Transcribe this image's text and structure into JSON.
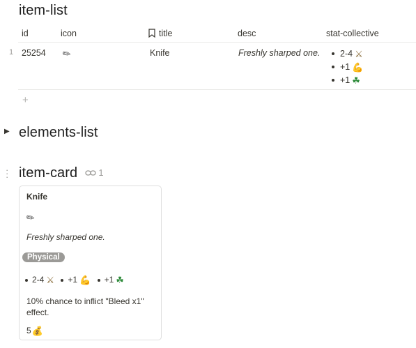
{
  "sections": {
    "item_list": "item-list",
    "elements_list": "elements-list",
    "item_card": "item-card",
    "item_card_links": "1"
  },
  "table": {
    "columns": {
      "id": "id",
      "icon": "icon",
      "title": "title",
      "desc": "desc",
      "stat": "stat-collective"
    },
    "rows": [
      {
        "num": "1",
        "id": "25254",
        "icon": "knife-icon",
        "title": "Knife",
        "desc": "Freshly sharped one.",
        "stats": [
          "2-4",
          "+1",
          "+1"
        ]
      }
    ],
    "add": "+"
  },
  "card": {
    "title": "Knife",
    "desc": "Freshly sharped one.",
    "badge": "Physical",
    "stats": [
      "2-4",
      "+1",
      "+1"
    ],
    "effect": "10% chance to inflict \"Bleed x1\" effect.",
    "price": "5"
  }
}
